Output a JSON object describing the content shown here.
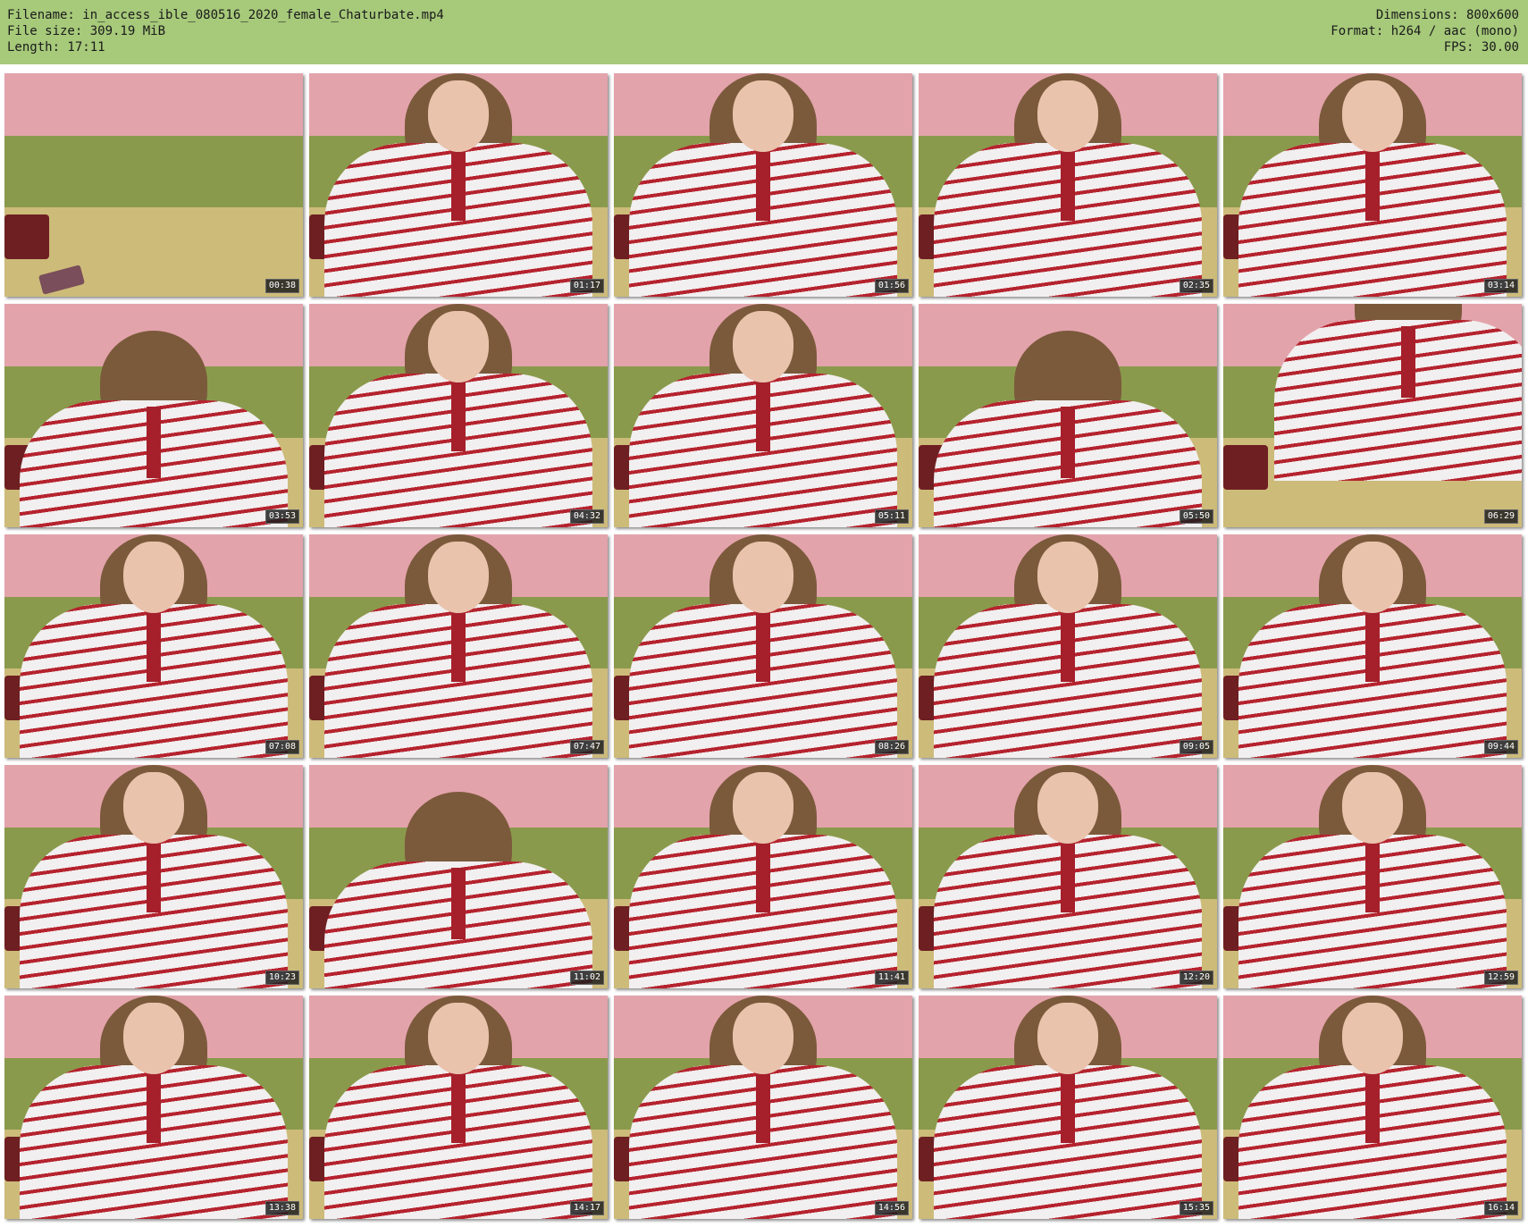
{
  "header": {
    "filename_line": "Filename: in_access_ible_080516_2020_female_Chaturbate.mp4",
    "filesize_line": "File size: 309.19 MiB",
    "length_line": "Length: 17:11",
    "dimensions_line": "Dimensions: 800x600",
    "format_line": "Format: h264 / aac (mono)",
    "fps_line": "FPS: 30.00",
    "background_color": "#a6c97a"
  },
  "thumbnails": [
    {
      "timestamp": "00:38",
      "scene": "empty-sofa"
    },
    {
      "timestamp": "01:17",
      "scene": "person"
    },
    {
      "timestamp": "01:56",
      "scene": "person"
    },
    {
      "timestamp": "02:35",
      "scene": "person"
    },
    {
      "timestamp": "03:14",
      "scene": "person"
    },
    {
      "timestamp": "03:53",
      "scene": "head-down"
    },
    {
      "timestamp": "04:32",
      "scene": "person"
    },
    {
      "timestamp": "05:11",
      "scene": "person"
    },
    {
      "timestamp": "05:50",
      "scene": "head-down"
    },
    {
      "timestamp": "06:29",
      "scene": "standing"
    },
    {
      "timestamp": "07:08",
      "scene": "person"
    },
    {
      "timestamp": "07:47",
      "scene": "person"
    },
    {
      "timestamp": "08:26",
      "scene": "person"
    },
    {
      "timestamp": "09:05",
      "scene": "person"
    },
    {
      "timestamp": "09:44",
      "scene": "person"
    },
    {
      "timestamp": "10:23",
      "scene": "person"
    },
    {
      "timestamp": "11:02",
      "scene": "head-down"
    },
    {
      "timestamp": "11:41",
      "scene": "person"
    },
    {
      "timestamp": "12:20",
      "scene": "person"
    },
    {
      "timestamp": "12:59",
      "scene": "person"
    },
    {
      "timestamp": "13:38",
      "scene": "person"
    },
    {
      "timestamp": "14:17",
      "scene": "person"
    },
    {
      "timestamp": "14:56",
      "scene": "person"
    },
    {
      "timestamp": "15:35",
      "scene": "person"
    },
    {
      "timestamp": "16:14",
      "scene": "person"
    }
  ]
}
